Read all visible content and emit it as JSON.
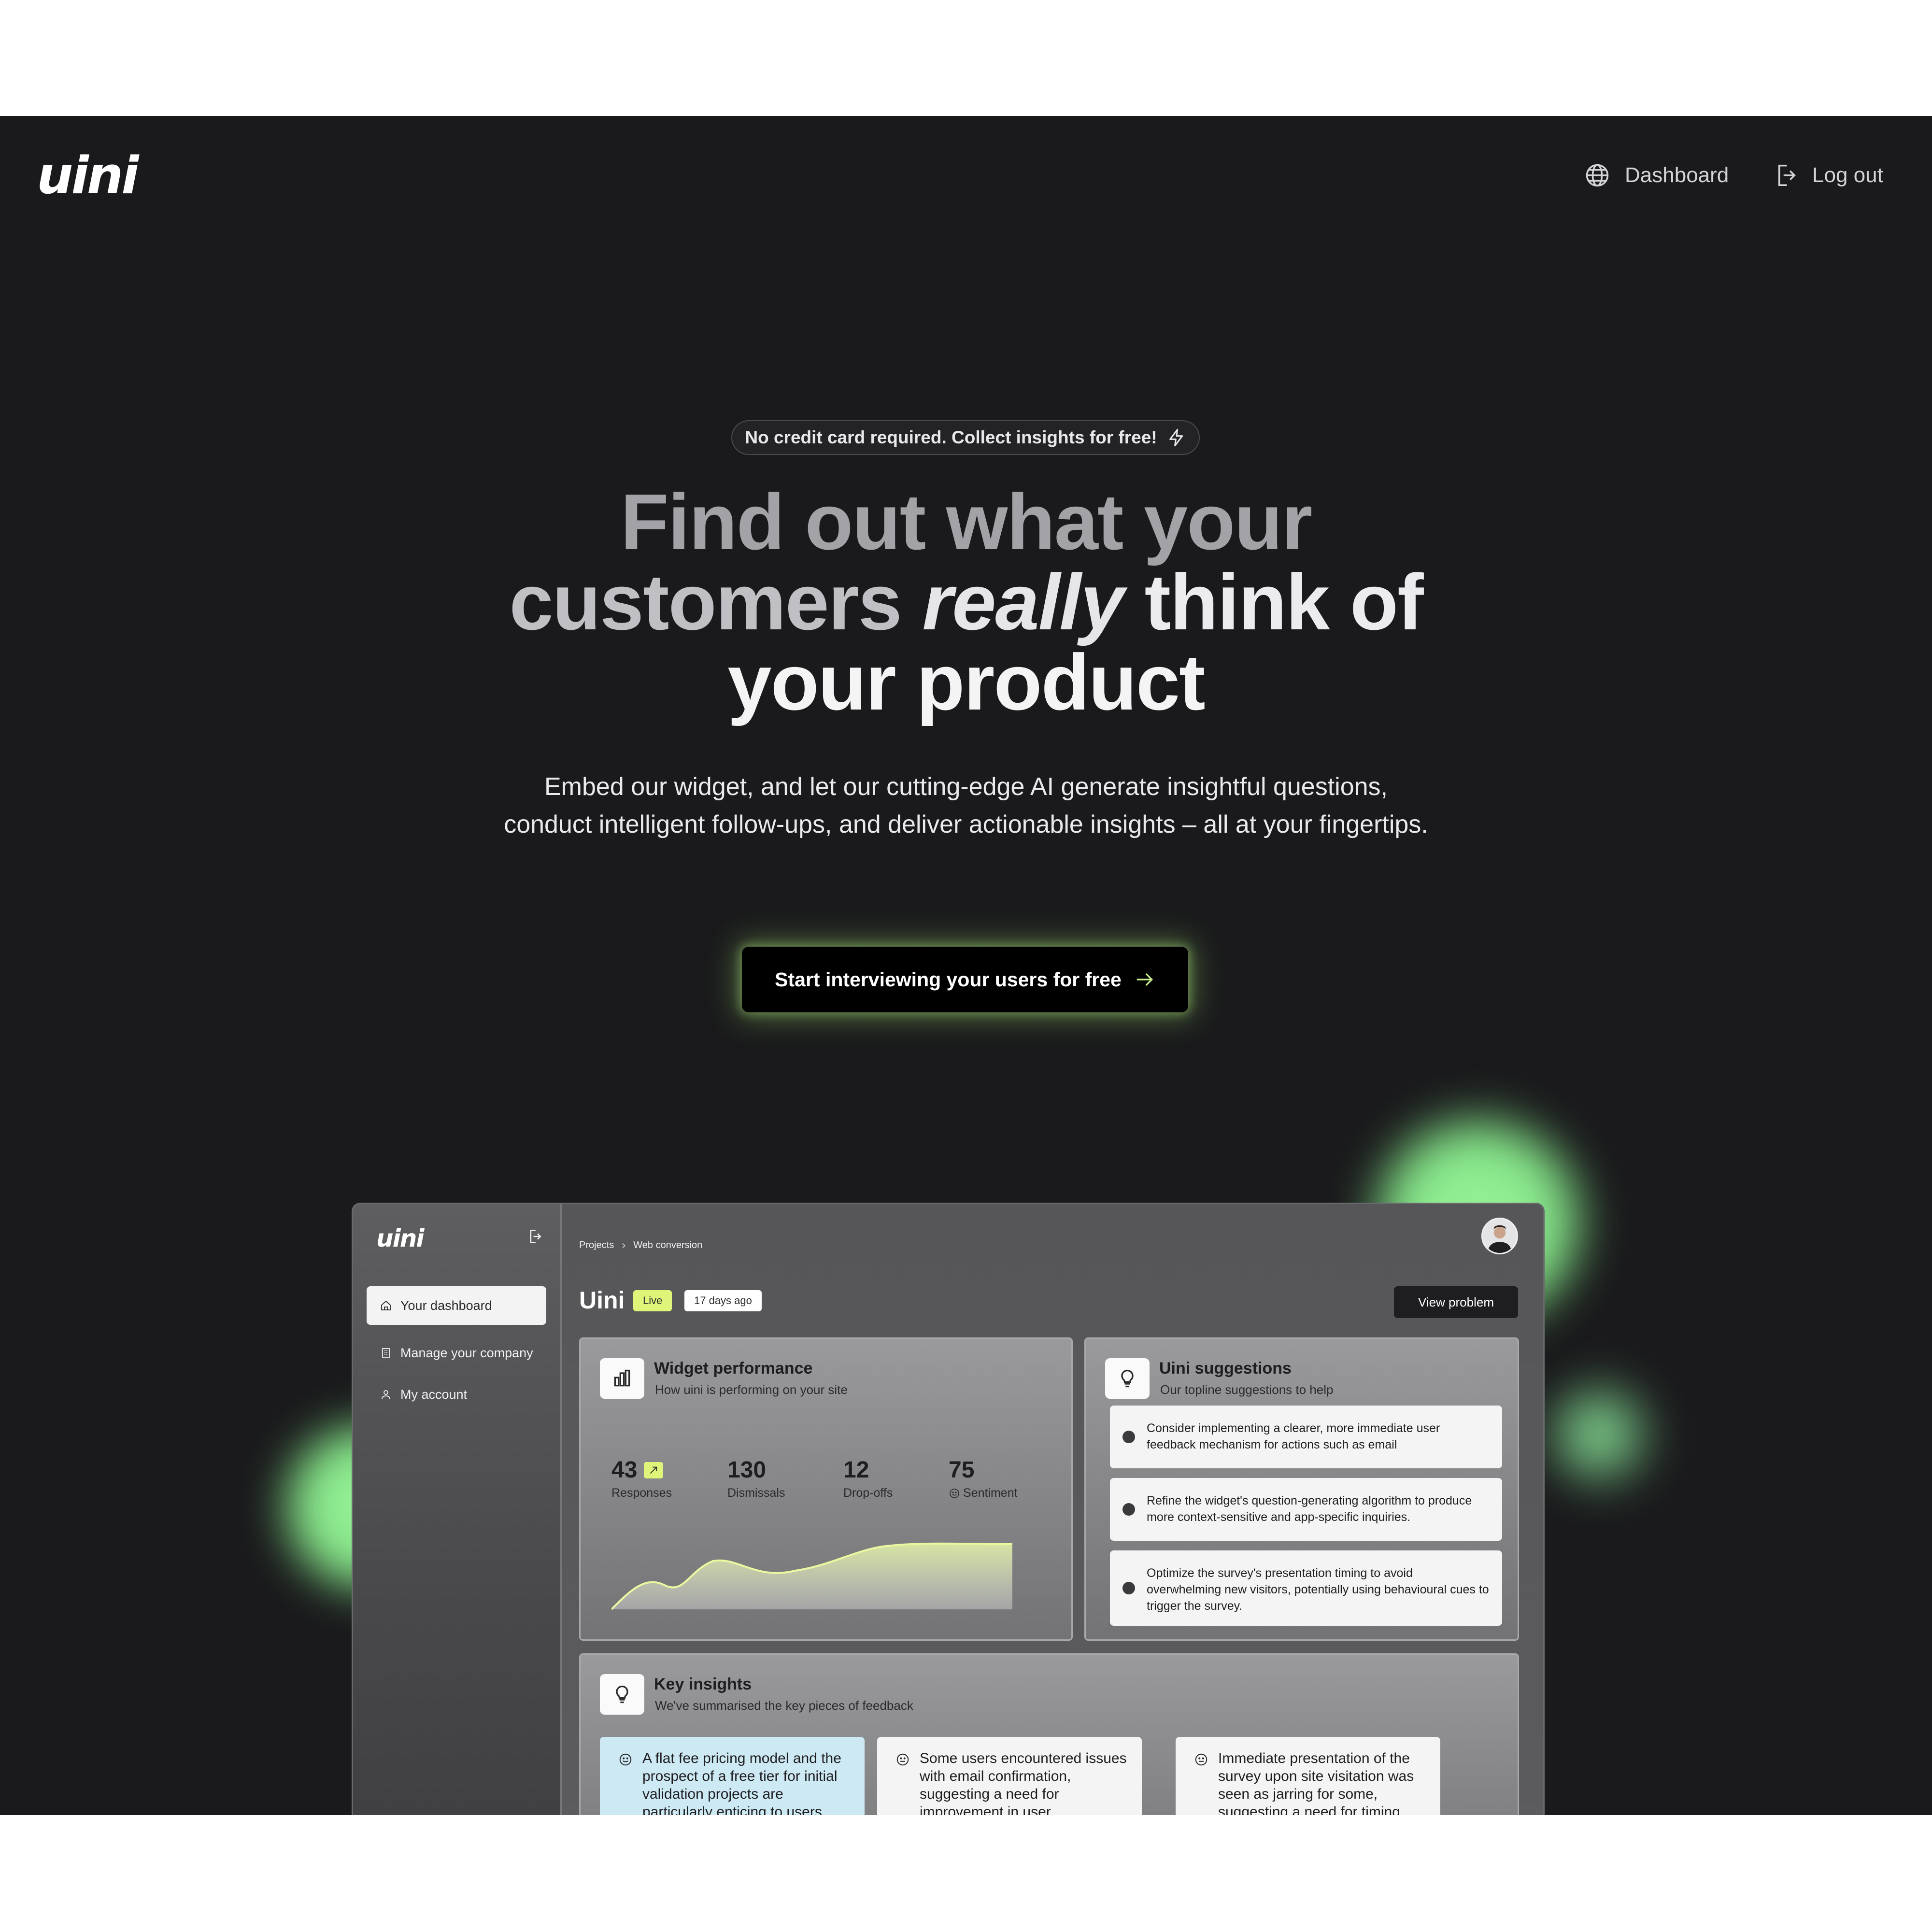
{
  "nav": {
    "logo": "uini",
    "dashboard_label": "Dashboard",
    "logout_label": "Log out"
  },
  "hero": {
    "promo": "No credit card required. Collect insights for free!",
    "headline_line1": "Find out what your",
    "headline_line2_a": "customers ",
    "headline_line2_b": "really",
    "headline_line2_c": " think of",
    "headline_line3": "your product",
    "subtext": "Embed our widget, and let our cutting-edge AI generate insightful questions, conduct intelligent follow-ups, and deliver actionable insights – all at your fingertips.",
    "cta_label": "Start interviewing your users for free"
  },
  "app": {
    "logo": "uini",
    "sidebar": {
      "items": [
        {
          "label": "Your dashboard",
          "icon": "home-icon"
        },
        {
          "label": "Manage your company",
          "icon": "building-icon"
        },
        {
          "label": "My account",
          "icon": "user-icon"
        }
      ]
    },
    "breadcrumb": [
      "Projects",
      "Web conversion"
    ],
    "project_title": "Uini",
    "status_badge": "Live",
    "age_badge": "17 days ago",
    "view_problem_label": "View problem",
    "widget_card": {
      "title": "Widget performance",
      "subtitle": "How uini is performing on your site",
      "stats": [
        {
          "value": "43",
          "label": "Responses"
        },
        {
          "value": "130",
          "label": "Dismissals"
        },
        {
          "value": "12",
          "label": "Drop-offs"
        },
        {
          "value": "75",
          "label": "Sentiment"
        }
      ]
    },
    "suggestions_card": {
      "title": "Uini suggestions",
      "subtitle": "Our topline suggestions to help",
      "items": [
        "Consider implementing a clearer, more immediate user feedback mechanism for actions such as email",
        "Refine the widget's question-generating algorithm to produce more context-sensitive and app-specific inquiries.",
        "Optimize the survey's presentation timing to avoid overwhelming new visitors, potentially using behavioural cues to trigger the survey."
      ]
    },
    "insights_card": {
      "title": "Key insights",
      "subtitle": "We've summarised the key pieces of feedback",
      "items": [
        "A flat fee pricing model and the prospect of a free tier for initial validation projects are particularly enticing to users.",
        "Some users encountered issues with email confirmation, suggesting a need for improvement in user",
        "Immediate presentation of the survey upon site visitation was seen as jarring for some, suggesting a need for timing"
      ]
    }
  },
  "colors": {
    "background": "#1a1a1c",
    "accent_green": "#9cf29a",
    "badge_lime": "#dff57a",
    "cta_bg": "#000000"
  }
}
